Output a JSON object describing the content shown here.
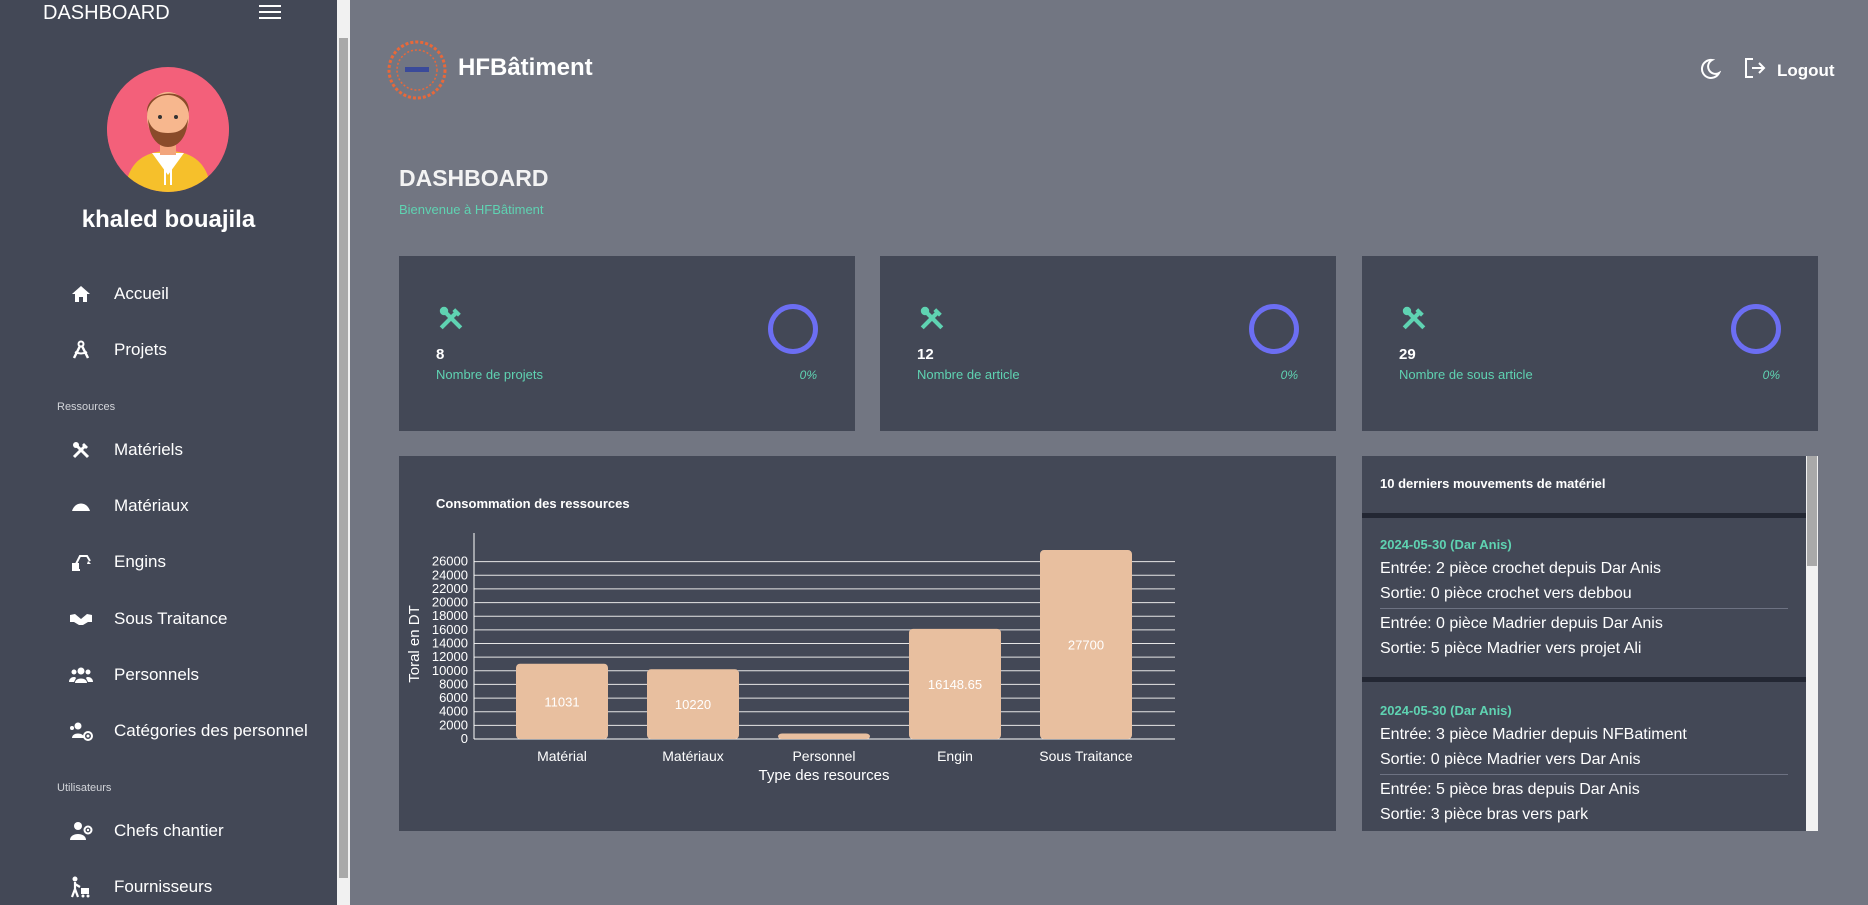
{
  "sidebar": {
    "title": "DASHBOARD",
    "user": "khaled bouajila",
    "items_top": [
      {
        "label": "Accueil",
        "icon": "home-icon"
      },
      {
        "label": "Projets",
        "icon": "compass-icon"
      }
    ],
    "section_resources": "Ressources",
    "items_resources": [
      {
        "label": "Matériels",
        "icon": "tools-icon"
      },
      {
        "label": "Matériaux",
        "icon": "mound-icon"
      },
      {
        "label": "Engins",
        "icon": "excavator-icon"
      },
      {
        "label": "Sous Traitance",
        "icon": "handshake-icon"
      },
      {
        "label": "Personnels",
        "icon": "users-icon"
      },
      {
        "label": "Catégories des personnel",
        "icon": "users-cog-icon"
      }
    ],
    "section_users": "Utilisateurs",
    "items_users": [
      {
        "label": "Chefs chantier",
        "icon": "user-gear-icon"
      },
      {
        "label": "Fournisseurs",
        "icon": "person-cart-icon"
      }
    ]
  },
  "header": {
    "brand": "HFBâtiment",
    "logout": "Logout"
  },
  "page": {
    "title": "DASHBOARD",
    "subtitle": "Bienvenue à HFBâtiment"
  },
  "stats": [
    {
      "value": "8",
      "label": "Nombre de projets",
      "percent": "0%"
    },
    {
      "value": "12",
      "label": "Nombre de article",
      "percent": "0%"
    },
    {
      "value": "29",
      "label": "Nombre de sous article",
      "percent": "0%"
    }
  ],
  "chart_title": "Consommation des ressources",
  "chart_data": {
    "type": "bar",
    "categories": [
      "Matérial",
      "Matériaux",
      "Personnel",
      "Engin",
      "Sous Traitance"
    ],
    "values": [
      11031,
      10220,
      800,
      16148.65,
      27700
    ],
    "data_labels": [
      "11031",
      "10220",
      "",
      "16148.65",
      "27700"
    ],
    "xlabel": "Type des resources",
    "ylabel": "Toral en DT",
    "yticks": [
      0,
      2000,
      4000,
      6000,
      8000,
      10000,
      12000,
      14000,
      16000,
      18000,
      20000,
      22000,
      24000,
      26000
    ],
    "ylim": [
      0,
      28000
    ],
    "grid": true,
    "bar_color": "#e8bf9f"
  },
  "movements": {
    "title": "10 derniers mouvements de matériel",
    "groups": [
      {
        "date": "2024-05-30 (Dar Anis)",
        "entries": [
          [
            "Entrée: 2 pièce crochet depuis Dar Anis",
            "Sortie: 0 pièce crochet vers debbou"
          ],
          [
            "Entrée: 0 pièce Madrier depuis Dar Anis",
            "Sortie: 5 pièce Madrier vers projet Ali"
          ]
        ]
      },
      {
        "date": "2024-05-30 (Dar Anis)",
        "entries": [
          [
            "Entrée: 3 pièce Madrier depuis NFBatiment",
            "Sortie: 0 pièce Madrier vers Dar Anis"
          ],
          [
            "Entrée: 5 pièce bras depuis Dar Anis",
            "Sortie: 3 pièce bras vers park"
          ]
        ]
      }
    ]
  },
  "colors": {
    "accent": "#5fd3b2",
    "ring": "#6c6ef2",
    "panel": "#434856",
    "background": "#727682"
  }
}
